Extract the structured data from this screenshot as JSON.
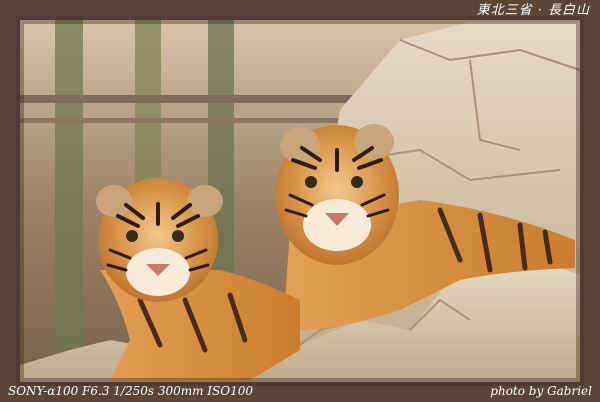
{
  "captions": {
    "location": "東北三省 · 長白山",
    "camera": "SONY-α100  F6.3  1/250s  300mm  ISO100",
    "credit": "photo by Gabriel"
  },
  "subjects": [
    {
      "name": "tiger-left",
      "pose": "lying, facing viewer"
    },
    {
      "name": "tiger-right",
      "pose": "lying, facing viewer, slightly larger"
    }
  ],
  "colors": {
    "frame": "#5a4636",
    "fur": "#d38d3f",
    "rock": "#d8c7ad",
    "background": "#9d8366",
    "text": "#ffffff"
  }
}
